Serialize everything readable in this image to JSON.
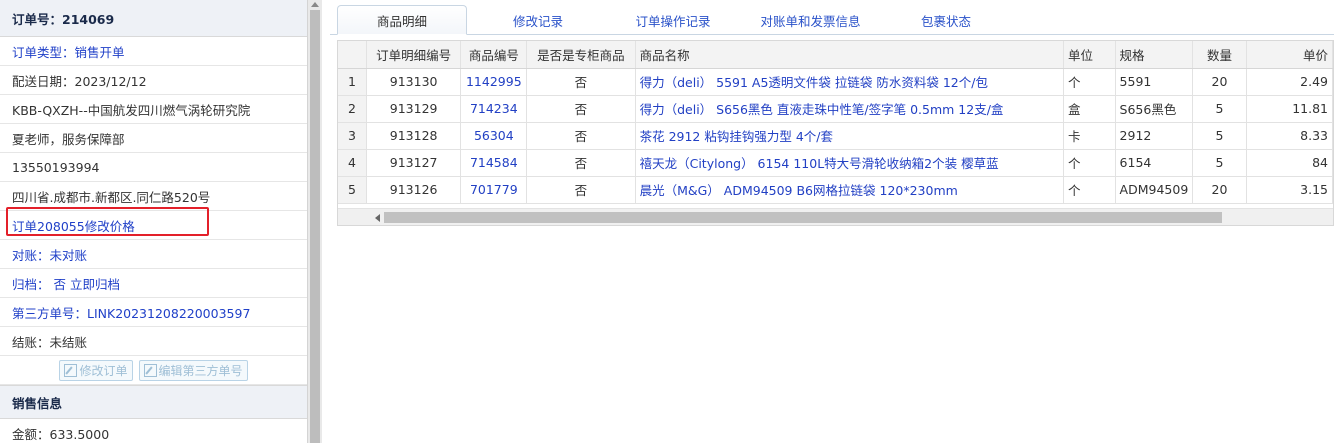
{
  "left_panel": {
    "order_number": "订单号：214069",
    "rows": [
      {
        "text": "订单类型：销售开单",
        "blue": true
      },
      {
        "text": "配送日期：2023/12/12",
        "blue": false
      },
      {
        "text": "KBB-QXZH--中国航发四川燃气涡轮研究院",
        "blue": false
      },
      {
        "text": "夏老师，服务保障部",
        "blue": false
      },
      {
        "text": "13550193994",
        "blue": false
      },
      {
        "text": "四川省.成都市.新都区.同仁路520号",
        "blue": false
      },
      {
        "text": "订单208055修改价格",
        "blue": true
      },
      {
        "text": "对账：未对账",
        "blue": true
      },
      {
        "text": "归档：  否  立即归档",
        "blue": true
      },
      {
        "text": "第三方单号：LINK20231208220003597",
        "blue": true
      },
      {
        "text": "结账：未结账",
        "blue": false
      }
    ],
    "edit_order_label": "修改订单",
    "edit_third_party_label": "编辑第三方单号",
    "sales_section_title": "销售信息",
    "amount": "金额：633.5000"
  },
  "tabs": [
    {
      "label": "商品明细",
      "active": true
    },
    {
      "label": "修改记录",
      "active": false
    },
    {
      "label": "订单操作记录",
      "active": false
    },
    {
      "label": "对账单和发票信息",
      "active": false
    },
    {
      "label": "包裹状态",
      "active": false
    }
  ],
  "table": {
    "headers": [
      "",
      "订单明细编号",
      "商品编号",
      "是否是专柜商品",
      "商品名称",
      "单位",
      "规格",
      "数量",
      "单价"
    ],
    "rows": [
      {
        "n": "1",
        "detail_id": "913130",
        "product_id": "1142995",
        "counter": "否",
        "name": "得力（deli） 5591 A5透明文件袋 拉链袋 防水资料袋 12个/包",
        "unit": "个",
        "spec": "5591",
        "qty": "20",
        "price": "2.49"
      },
      {
        "n": "2",
        "detail_id": "913129",
        "product_id": "714234",
        "counter": "否",
        "name": "得力（deli） S656黑色 直液走珠中性笔/签字笔 0.5mm 12支/盒",
        "unit": "盒",
        "spec": "S656黑色",
        "qty": "5",
        "price": "11.81"
      },
      {
        "n": "3",
        "detail_id": "913128",
        "product_id": "56304",
        "counter": "否",
        "name": "茶花 2912 粘钩挂钩强力型 4个/套",
        "unit": "卡",
        "spec": "2912",
        "qty": "5",
        "price": "8.33"
      },
      {
        "n": "4",
        "detail_id": "913127",
        "product_id": "714584",
        "counter": "否",
        "name": "禧天龙（Citylong） 6154 110L特大号滑轮收纳箱2个装 樱草蓝",
        "unit": "个",
        "spec": "6154",
        "qty": "5",
        "price": "84"
      },
      {
        "n": "5",
        "detail_id": "913126",
        "product_id": "701779",
        "counter": "否",
        "name": "晨光（M&G） ADM94509 B6网格拉链袋 120*230mm",
        "unit": "个",
        "spec": "ADM94509",
        "qty": "20",
        "price": "3.15"
      }
    ]
  }
}
